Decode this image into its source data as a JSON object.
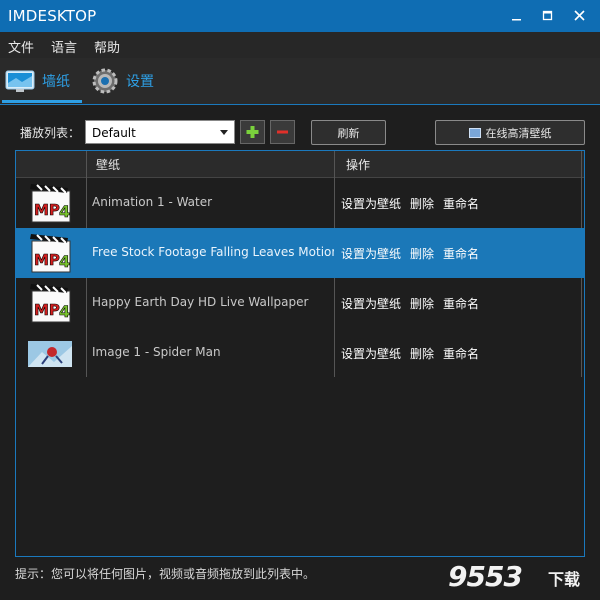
{
  "window": {
    "title": "IMDESKTOP"
  },
  "menu": [
    "文件",
    "语言",
    "帮助"
  ],
  "tabs": [
    {
      "label": "墙纸",
      "active": true
    },
    {
      "label": "设置",
      "active": false
    }
  ],
  "toolbar": {
    "playlist_label": "播放列表：",
    "playlist_value": "Default",
    "refresh_label": "刷新",
    "online_label": "在线高清壁纸"
  },
  "table": {
    "headers": [
      "壁纸",
      "操作"
    ],
    "rows": [
      {
        "name": "Animation 1 - Water",
        "thumb": "mp4-icon",
        "selected": false
      },
      {
        "name": "Free Stock Footage Falling Leaves Motion Backgr",
        "thumb": "mp4-icon",
        "selected": true
      },
      {
        "name": "Happy Earth Day HD Live Wallpaper",
        "thumb": "mp4-icon",
        "selected": false
      },
      {
        "name": "Image 1 - Spider Man",
        "thumb": "image-thumbnail",
        "selected": false
      }
    ],
    "row_actions": [
      "设置为壁纸",
      "删除",
      "重命名"
    ]
  },
  "hint": "提示：您可以将任何图片，视频或音频拖放到此列表中。",
  "watermark": {
    "number": "9553",
    "suffix": "下载"
  },
  "colors": {
    "accent": "#1b78b8",
    "titlebar": "#0f6db3",
    "tab_text": "#2ea0e6"
  }
}
